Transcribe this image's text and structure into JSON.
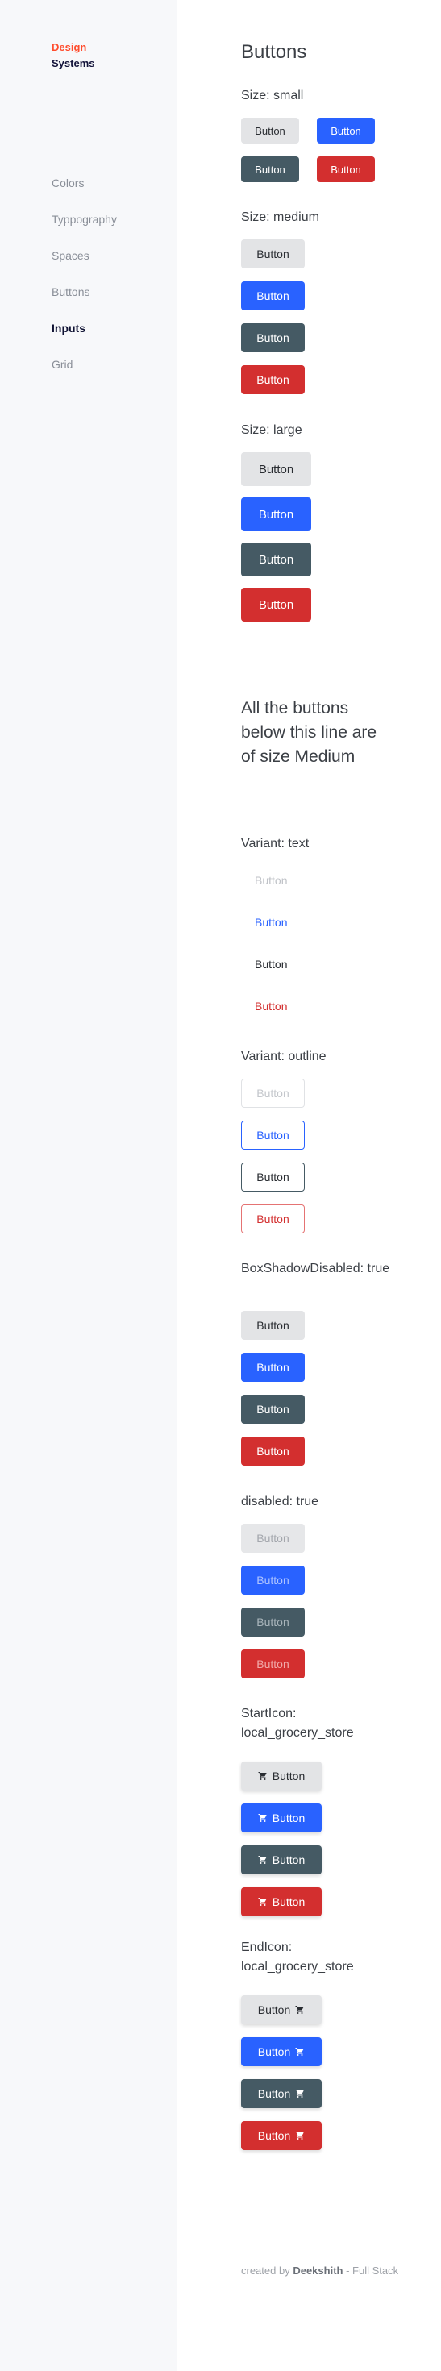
{
  "logo": {
    "line1": "Design",
    "line2": "Systems"
  },
  "nav": [
    {
      "label": "Colors",
      "active": false
    },
    {
      "label": "Typpography",
      "active": false
    },
    {
      "label": "Spaces",
      "active": false
    },
    {
      "label": "Buttons",
      "active": false
    },
    {
      "label": "Inputs",
      "active": true
    },
    {
      "label": "Grid",
      "active": false
    }
  ],
  "page_title": "Buttons",
  "button_label": "Button",
  "sections": {
    "small": "Size: small",
    "medium": "Size: medium",
    "large": "Size: large",
    "note": "All the buttons below this line are of size Medium",
    "text": "Variant: text",
    "outline": "Variant: outline",
    "shadow": "BoxShadowDisabled: true",
    "disabled": "disabled: true",
    "start_icon": "StartIcon: local_grocery_store",
    "end_icon": "EndIcon: local_grocery_store"
  },
  "icon": "local-grocery-store-icon",
  "footer": {
    "prefix": "created by",
    "author": "Deekshith",
    "suffix": "- Full Stack"
  },
  "colors": {
    "default": "#e3e4e6",
    "primary": "#2962ff",
    "secondary": "#455a64",
    "danger": "#d32f2f",
    "logo_accent": "#ff4d2d"
  }
}
